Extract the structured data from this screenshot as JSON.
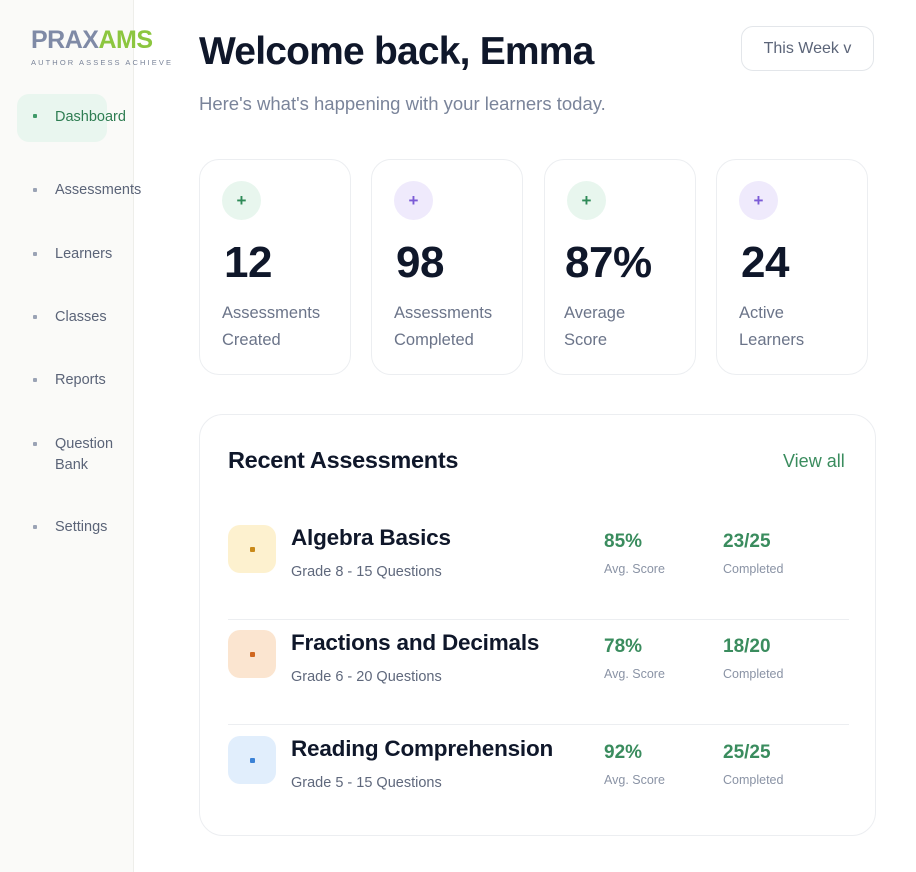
{
  "brand": {
    "name_part1": "PRAX",
    "name_part2": "AMS",
    "tagline": "AUTHOR ASSESS ACHIEVE"
  },
  "sidebar": {
    "items": [
      {
        "label": "Dashboard",
        "active": true
      },
      {
        "label": "Assessments"
      },
      {
        "label": "Learners"
      },
      {
        "label": "Classes"
      },
      {
        "label": "Reports"
      },
      {
        "label": "Question",
        "label2": "Bank"
      },
      {
        "label": "Settings"
      }
    ]
  },
  "header": {
    "title": "Welcome back, Emma",
    "subtitle": "Here's what's happening with your learners today.",
    "period": "This Week v"
  },
  "stats": [
    {
      "value": "12",
      "line1": "Assessments",
      "line2": "Created",
      "accent": "green"
    },
    {
      "value": "98",
      "line1": "Assessments",
      "line2": "Completed",
      "accent": "purple"
    },
    {
      "value": "87%",
      "line1": "Average",
      "line2": "Score",
      "accent": "green"
    },
    {
      "value": "24",
      "line1": "Active",
      "line2": "Learners",
      "accent": "purple"
    }
  ],
  "plus_glyph": "+",
  "recent": {
    "title": "Recent Assessments",
    "view_all": "View all",
    "items": [
      {
        "name": "Algebra Basics",
        "meta": "Grade 8 - 15 Questions",
        "avg": "85%",
        "avg_label": "Avg. Score",
        "completed": "23/25",
        "completed_label": "Completed",
        "icon_bg": "#fdf1cf",
        "icon_color": "#c98a1a"
      },
      {
        "name": "Fractions and Decimals",
        "meta": "Grade 6 - 20 Questions",
        "avg": "78%",
        "avg_label": "Avg. Score",
        "completed": "18/20",
        "completed_label": "Completed",
        "icon_bg": "#fbe5d0",
        "icon_color": "#d0671f"
      },
      {
        "name": "Reading Comprehension",
        "meta": "Grade 5 - 15 Questions",
        "avg": "92%",
        "avg_label": "Avg. Score",
        "completed": "25/25",
        "completed_label": "Completed",
        "icon_bg": "#e1eefc",
        "icon_color": "#3b82d6"
      }
    ]
  },
  "colors": {
    "accent_green": "#3a8c5e",
    "brand_gray": "#7f8aa6",
    "brand_lime": "#8cc63f",
    "active_bg": "#e9f6ef"
  }
}
